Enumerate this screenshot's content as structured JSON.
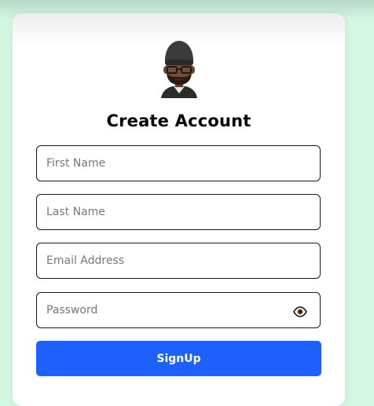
{
  "form": {
    "title": "Create Account",
    "first_name": {
      "placeholder": "First Name",
      "value": ""
    },
    "last_name": {
      "placeholder": "Last Name",
      "value": ""
    },
    "email": {
      "placeholder": "Email Address",
      "value": ""
    },
    "password": {
      "placeholder": "Password",
      "value": ""
    },
    "submit_label": "SignUp"
  },
  "icons": {
    "avatar": "memoji-avatar",
    "password_toggle": "eye-icon"
  },
  "colors": {
    "page_background": "#d4f7e4",
    "card_background": "#ffffff",
    "button": "#1e60fc",
    "button_text": "#ffffff",
    "field_border": "#1a1a1a"
  }
}
